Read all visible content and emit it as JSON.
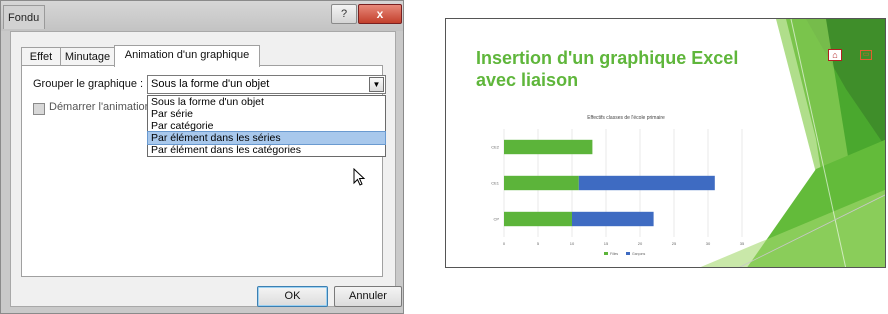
{
  "dialog": {
    "title": "Fondu",
    "help_label": "?",
    "close_label": "x",
    "tabs": [
      {
        "label": "Effet"
      },
      {
        "label": "Minutage"
      },
      {
        "label": "Animation d'un graphique"
      }
    ],
    "group_label": "Grouper le graphique :",
    "group_value": "Sous la forme d'un objet",
    "checkbox_label": "Démarrer l'animation",
    "options": [
      {
        "label": "Sous la forme d'un objet"
      },
      {
        "label": "Par série"
      },
      {
        "label": "Par catégorie"
      },
      {
        "label": "Par élément dans les séries"
      },
      {
        "label": "Par élément dans les catégories"
      }
    ],
    "highlighted_option": "Par élément dans les séries",
    "ok_label": "OK",
    "cancel_label": "Annuler"
  },
  "slide": {
    "title": "Insertion d'un graphique Excel avec liaison",
    "chart_data": {
      "type": "bar",
      "orientation": "horizontal",
      "stacked": true,
      "title": "Effectifs classes de l'école primaire",
      "categories": [
        "CE2",
        "CE1",
        "CP"
      ],
      "series": [
        {
          "name": "Filles",
          "values": [
            13,
            11,
            10
          ],
          "color": "#5cb43a"
        },
        {
          "name": "Garçons",
          "values": [
            0,
            20,
            12
          ],
          "color": "#3e6bc2"
        }
      ],
      "xlim": [
        0,
        35
      ],
      "x_ticks": [
        0,
        5,
        10,
        15,
        20,
        25,
        30,
        35
      ],
      "grid": true,
      "legend": "bottom"
    },
    "colors": {
      "accent": "#5fb63b",
      "dark_green": "#3f8e2a"
    }
  }
}
